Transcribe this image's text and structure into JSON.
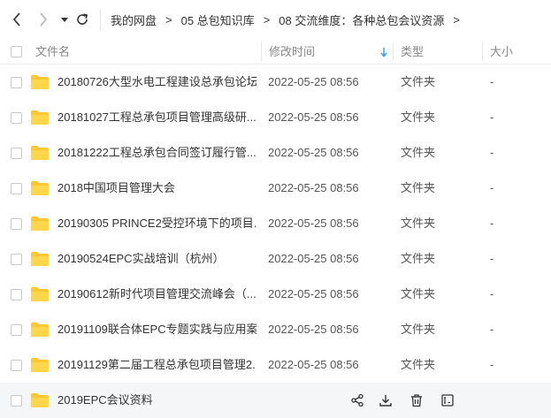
{
  "breadcrumb": {
    "items": [
      "我的网盘",
      "05 总包知识库",
      "08 交流维度：各种总包会议资源"
    ],
    "separator": ">"
  },
  "columns": {
    "name": "文件名",
    "modified": "修改时间",
    "type": "类型",
    "size": "大小"
  },
  "files": [
    {
      "name": "20180726大型水电工程建设总承包论坛",
      "modified": "2022-05-25 08:56",
      "type": "文件夹",
      "size": "-"
    },
    {
      "name": "20181027工程总承包项目管理高级研...",
      "modified": "2022-05-25 08:56",
      "type": "文件夹",
      "size": "-"
    },
    {
      "name": "20181222工程总承包合同签订履行管...",
      "modified": "2022-05-25 08:56",
      "type": "文件夹",
      "size": "-"
    },
    {
      "name": "2018中国项目管理大会",
      "modified": "2022-05-25 08:56",
      "type": "文件夹",
      "size": "-"
    },
    {
      "name": "20190305 PRINCE2受控环境下的项目...",
      "modified": "2022-05-25 08:56",
      "type": "文件夹",
      "size": "-"
    },
    {
      "name": "20190524EPC实战培训（杭州）",
      "modified": "2022-05-25 08:56",
      "type": "文件夹",
      "size": "-"
    },
    {
      "name": "20190612新时代项目管理交流峰会（...",
      "modified": "2022-05-25 08:56",
      "type": "文件夹",
      "size": "-"
    },
    {
      "name": "20191109联合体EPC专题实践与应用案...",
      "modified": "2022-05-25 08:56",
      "type": "文件夹",
      "size": "-"
    },
    {
      "name": "20191129第二届工程总承包项目管理2...",
      "modified": "2022-05-25 08:56",
      "type": "文件夹",
      "size": "-"
    },
    {
      "name": "2019EPC会议资料",
      "modified": "",
      "type": "",
      "size": ""
    }
  ],
  "icons": {
    "back": "chevron-left-icon",
    "forward": "chevron-right-icon",
    "history": "caret-down-icon",
    "refresh": "refresh-icon",
    "folder": "folder-icon",
    "sort": "sort-down-arrow-icon",
    "share": "share-icon",
    "download": "download-icon",
    "delete": "trash-icon",
    "more": "rename-icon"
  },
  "colors": {
    "folder": "#FFC830",
    "sort_arrow": "#2b9cf2",
    "hover_row": "#f5f6f8"
  }
}
